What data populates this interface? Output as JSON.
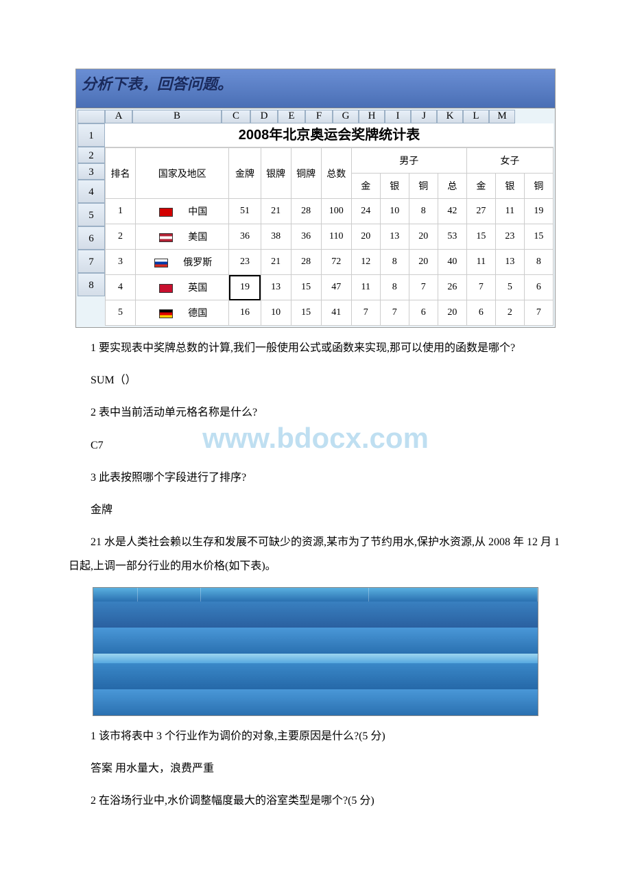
{
  "fig1": {
    "prompt_title": "分析下表，回答问题。",
    "columns": [
      "A",
      "B",
      "C",
      "D",
      "E",
      "F",
      "G",
      "H",
      "I",
      "J",
      "K",
      "L",
      "M"
    ],
    "row_headers": [
      "1",
      "2",
      "3",
      "4",
      "5",
      "6",
      "7",
      "8"
    ],
    "sheet_title": "2008年北京奥运会奖牌统计表",
    "headers": {
      "rank": "排名",
      "country": "国家及地区",
      "gold": "金牌",
      "silver": "银牌",
      "bronze": "铜牌",
      "total": "总数",
      "male": "男子",
      "female": "女子",
      "sub_gold": "金",
      "sub_silver": "银",
      "sub_bronze": "铜",
      "sub_total": "总"
    },
    "rows": [
      {
        "rank": "1",
        "flag": "cn",
        "country": "中国",
        "g": "51",
        "s": "21",
        "b": "28",
        "t": "100",
        "mg": "24",
        "ms": "10",
        "mb": "8",
        "mt": "42",
        "fg": "27",
        "fs": "11",
        "fb": "19"
      },
      {
        "rank": "2",
        "flag": "us",
        "country": "美国",
        "g": "36",
        "s": "38",
        "b": "36",
        "t": "110",
        "mg": "20",
        "ms": "13",
        "mb": "20",
        "mt": "53",
        "fg": "15",
        "fs": "23",
        "fb": "15"
      },
      {
        "rank": "3",
        "flag": "ru",
        "country": "俄罗斯",
        "g": "23",
        "s": "21",
        "b": "28",
        "t": "72",
        "mg": "12",
        "ms": "8",
        "mb": "20",
        "mt": "40",
        "fg": "11",
        "fs": "13",
        "fb": "8"
      },
      {
        "rank": "4",
        "flag": "uk",
        "country": "英国",
        "g": "19",
        "s": "13",
        "b": "15",
        "t": "47",
        "mg": "11",
        "ms": "8",
        "mb": "7",
        "mt": "26",
        "fg": "7",
        "fs": "5",
        "fb": "6"
      },
      {
        "rank": "5",
        "flag": "de",
        "country": "德国",
        "g": "16",
        "s": "10",
        "b": "15",
        "t": "41",
        "mg": "7",
        "ms": "7",
        "mb": "6",
        "mt": "20",
        "fg": "6",
        "fs": "2",
        "fb": "7"
      }
    ],
    "active_cell": "C7"
  },
  "qa_block_1": {
    "q1": "1 要实现表中奖牌总数的计算,我们一般使用公式或函数来实现,那可以使用的函数是哪个?",
    "a1": "SUM（）",
    "q2": "2 表中当前活动单元格名称是什么?",
    "a2": "C7",
    "q3": "3 此表按照哪个字段进行了排序?",
    "a3": "金牌"
  },
  "watermark": "www.bdocx.com",
  "q21_intro": "21 水是人类社会赖以生存和发展不可缺少的资源,某市为了节约用水,保护水资源,从 2008 年 12 月 1 日起,上调一部分行业的用水价格(如下表)。",
  "qa_block_2": {
    "q1": "1 该市将表中 3 个行业作为调价的对象,主要原因是什么?(5 分)",
    "a1": "答案 用水量大，浪费严重",
    "q2": "2 在浴场行业中,水价调整幅度最大的浴室类型是哪个?(5 分)"
  },
  "chart_data": {
    "type": "table",
    "title": "2008年北京奥运会奖牌统计表",
    "columns": [
      "排名",
      "国家及地区",
      "金牌",
      "银牌",
      "铜牌",
      "总数",
      "男子-金",
      "男子-银",
      "男子-铜",
      "男子-总",
      "女子-金",
      "女子-银",
      "女子-铜"
    ],
    "rows": [
      [
        "1",
        "中国",
        51,
        21,
        28,
        100,
        24,
        10,
        8,
        42,
        27,
        11,
        19
      ],
      [
        "2",
        "美国",
        36,
        38,
        36,
        110,
        20,
        13,
        20,
        53,
        15,
        23,
        15
      ],
      [
        "3",
        "俄罗斯",
        23,
        21,
        28,
        72,
        12,
        8,
        20,
        40,
        11,
        13,
        8
      ],
      [
        "4",
        "英国",
        19,
        13,
        15,
        47,
        11,
        8,
        7,
        26,
        7,
        5,
        6
      ],
      [
        "5",
        "德国",
        16,
        10,
        15,
        41,
        7,
        7,
        6,
        20,
        6,
        2,
        7
      ]
    ],
    "active_cell": "C7"
  }
}
